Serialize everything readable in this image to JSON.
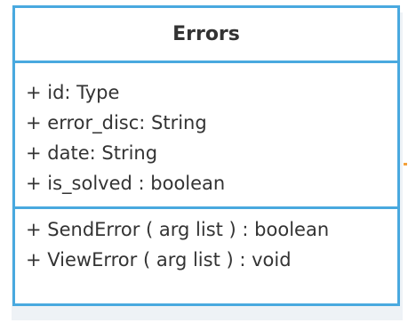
{
  "class": {
    "name": "Errors",
    "attributes": [
      "+ id: Type",
      "+ error_disc: String",
      "+ date: String",
      "+ is_solved : boolean"
    ],
    "methods": [
      "+ SendError ( arg list ) : boolean",
      "+ ViewError ( arg list ) : void"
    ]
  },
  "colors": {
    "border": "#49a9df",
    "text": "#333333",
    "shadow": "#eef2f6"
  }
}
